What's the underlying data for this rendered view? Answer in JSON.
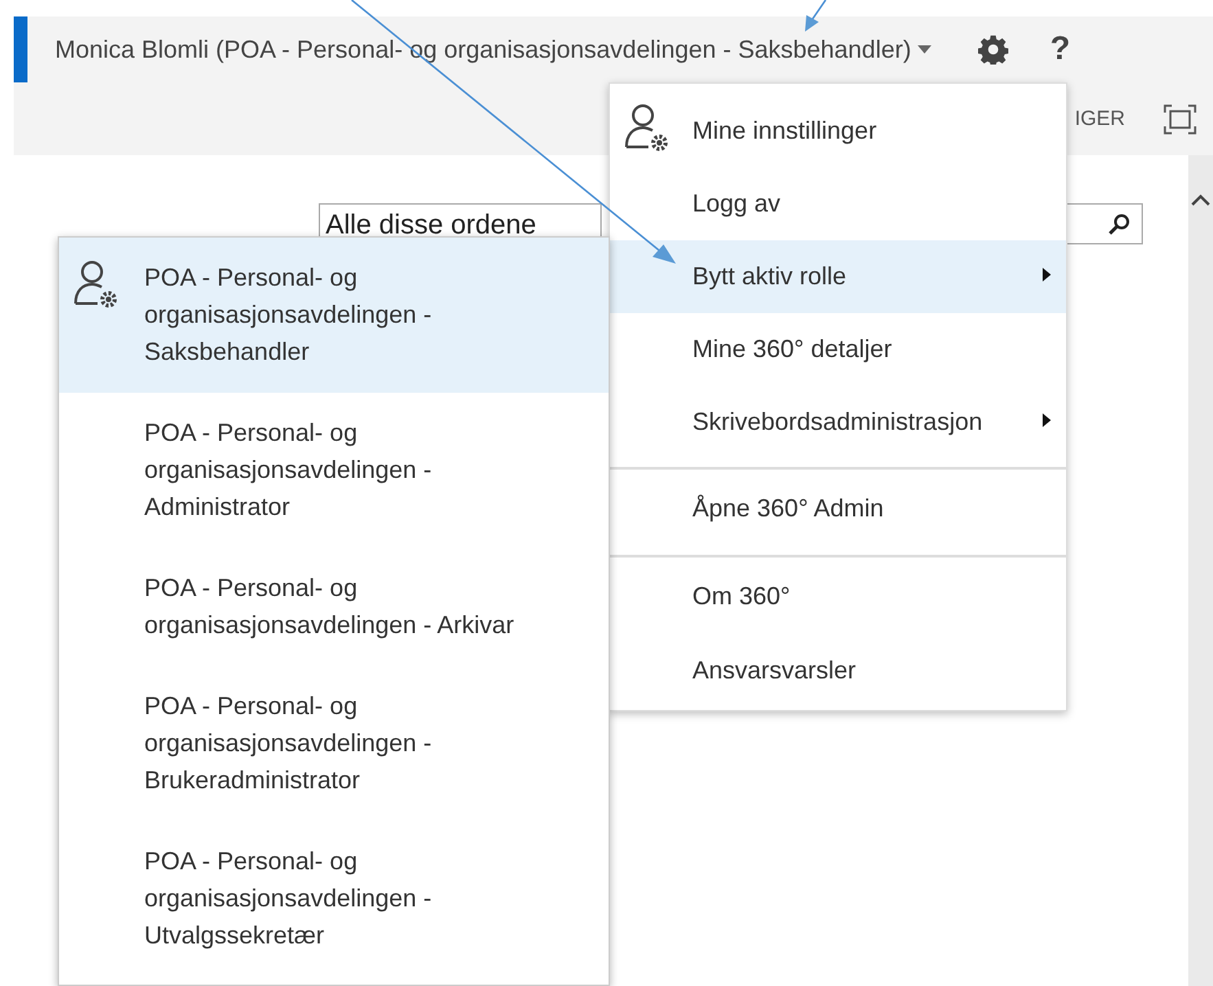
{
  "header": {
    "user_label": "Monica Blomli (POA - Personal- og organisasjonsavdelingen - Saksbehandler)",
    "help": "?"
  },
  "toolbar": {
    "partial_label": "IGER"
  },
  "search": {
    "value": "Alle disse ordene"
  },
  "user_menu": {
    "items": [
      {
        "label": "Mine innstillinger",
        "kind": "icon",
        "selected": false,
        "divider_before": false
      },
      {
        "label": "Logg av",
        "kind": "plain",
        "selected": false,
        "divider_before": false
      },
      {
        "label": "Bytt aktiv rolle",
        "kind": "submenu",
        "selected": true,
        "divider_before": false
      },
      {
        "label": "Mine 360° detaljer",
        "kind": "plain",
        "selected": false,
        "divider_before": false
      },
      {
        "label": "Skrivebordsadministrasjon",
        "kind": "submenu",
        "selected": false,
        "divider_before": false
      },
      {
        "label": "Åpne 360° Admin",
        "kind": "plain",
        "selected": false,
        "divider_before": true
      },
      {
        "label": "Om 360°",
        "kind": "plain",
        "selected": false,
        "divider_before": true
      },
      {
        "label": "Ansvarsvarsler",
        "kind": "plain",
        "selected": false,
        "divider_before": false
      }
    ]
  },
  "role_menu": {
    "items": [
      {
        "label": "POA - Personal- og organisasjonsavdelingen - Saksbehandler",
        "selected": true
      },
      {
        "label": "POA - Personal- og organisasjonsavdelingen - Administrator",
        "selected": false
      },
      {
        "label": "POA - Personal- og organisasjonsavdelingen - Arkivar",
        "selected": false
      },
      {
        "label": "POA - Personal- og organisasjonsavdelingen - Brukeradministrator",
        "selected": false
      },
      {
        "label": "POA - Personal- og organisasjonsavdelingen - Utvalgssekretær",
        "selected": false
      }
    ]
  }
}
